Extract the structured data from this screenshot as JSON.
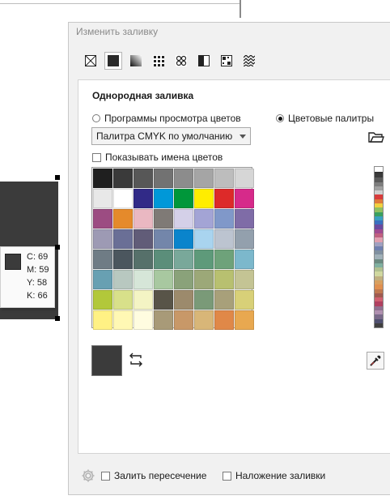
{
  "dialog": {
    "title": "Изменить заливку",
    "toolbar_icons": [
      "no-fill-icon",
      "uniform-fill-icon",
      "fountain-fill-icon",
      "vector-pattern-icon",
      "bitmap-pattern-icon",
      "two-color-pattern-icon",
      "texture-fill-icon",
      "postscript-fill-icon"
    ],
    "toolbar_active_index": 1,
    "section_title": "Однородная заливка",
    "radio_viewers": "Программы просмотра цветов",
    "radio_palettes": "Цветовые палитры",
    "radio_selected": "palettes",
    "palette_select_value": "Палитра CMYK по умолчанию",
    "show_names_label": "Показывать имена цветов",
    "show_names_checked": false,
    "current_color": "#3b3b3b",
    "swatches": [
      "#1f1f1f",
      "#3a3a3a",
      "#575757",
      "#727272",
      "#8c8c8c",
      "#a5a5a5",
      "#bdbdbd",
      "#d6d6d6",
      "#e8e8e8",
      "#ffffff",
      "#312a87",
      "#0098d8",
      "#00973a",
      "#ffed00",
      "#dd2a29",
      "#d62a8a",
      "#9c4c82",
      "#e58a2b",
      "#eab8c2",
      "#7f7a76",
      "#d4d0e8",
      "#a3a4d5",
      "#8098c9",
      "#7f6ca7",
      "#9d9ab4",
      "#6a6f96",
      "#615c78",
      "#7386aa",
      "#0a84cc",
      "#a9d4ef",
      "#bcc4d0",
      "#93a0ad",
      "#6f7c85",
      "#4b565e",
      "#56706a",
      "#5b8e7a",
      "#79a89a",
      "#5e9a7a",
      "#6ea27a",
      "#7cb8cc",
      "#68a0b2",
      "#b8c8c0",
      "#d6e6d8",
      "#a8c8a0",
      "#8aa27a",
      "#9ca878",
      "#b8c070",
      "#c4c494",
      "#b2c83a",
      "#d8e08a",
      "#f4f4c4",
      "#585448",
      "#9c8a6c",
      "#7a9a78",
      "#a8a07a",
      "#d8d078",
      "#fff184",
      "#fff8b4",
      "#fffce0",
      "#a89a78",
      "#c89868",
      "#d8b678",
      "#e08848",
      "#e8a850"
    ],
    "palette_strip_colors": [
      "#3b3b3b",
      "#5a5a5a",
      "#7d7d7d",
      "#a0a0a0",
      "#cfcfcf",
      "#d83c3c",
      "#e07a3a",
      "#f0d040",
      "#90c060",
      "#3aa060",
      "#3aa0c0",
      "#3a70c0",
      "#6a4aa0",
      "#a04a90",
      "#c06080",
      "#e0a0b0",
      "#a0a0c0",
      "#7080b0",
      "#8090a0",
      "#a0b0b8",
      "#6a8a80",
      "#80b0a0",
      "#b0c090",
      "#d0d8a0",
      "#c0b080",
      "#d8a060",
      "#e09050",
      "#c07850",
      "#a05a50",
      "#d06070",
      "#b04060",
      "#907090",
      "#b090b0",
      "#7a6a8a",
      "#505070",
      "#404040"
    ],
    "fill_intersection_label": "Залить пересечение",
    "fill_intersection_checked": false,
    "fill_overlay_label": "Наложение заливки",
    "fill_overlay_checked": false
  },
  "canvas": {
    "shape_color": "#3b3b3b",
    "tooltip": {
      "c": "C: 69",
      "m": "M: 59",
      "y": "Y: 58",
      "k": "K: 66"
    }
  }
}
